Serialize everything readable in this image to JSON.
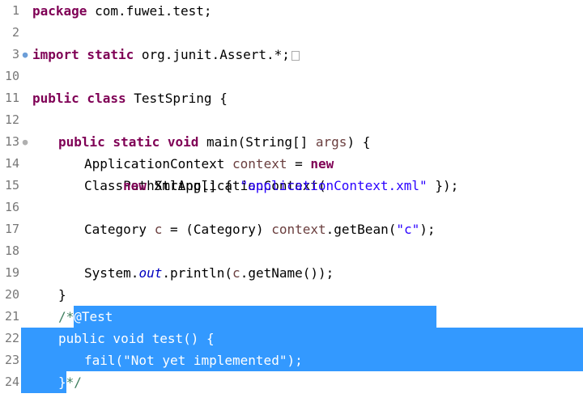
{
  "lines": [
    {
      "num": "1",
      "marker": "",
      "segments": [
        [
          "kw",
          "package "
        ],
        [
          "pkg",
          "com.fuwei.test"
        ],
        [
          "plain",
          ";"
        ]
      ]
    },
    {
      "num": "2",
      "marker": "",
      "segments": []
    },
    {
      "num": "3",
      "marker": "import",
      "segments": [
        [
          "kw",
          "import static "
        ],
        [
          "pkg",
          "org.junit.Assert.*"
        ],
        [
          "plain",
          ";"
        ]
      ],
      "fold": true
    },
    {
      "num": "10",
      "marker": "",
      "segments": []
    },
    {
      "num": "11",
      "marker": "",
      "segments": [
        [
          "kw",
          "public class "
        ],
        [
          "type",
          "TestSpring "
        ],
        [
          "plain",
          "{"
        ]
      ]
    },
    {
      "num": "12",
      "marker": "",
      "segments": []
    },
    {
      "num": "13",
      "marker": "method",
      "indent": 1,
      "segments": [
        [
          "kw",
          "public static void "
        ],
        [
          "type",
          "main"
        ],
        [
          "plain",
          "("
        ],
        [
          "type",
          "String"
        ],
        [
          "plain",
          "[] "
        ],
        [
          "var",
          "args"
        ],
        [
          "plain",
          ") {"
        ]
      ]
    },
    {
      "num": "14",
      "marker": "",
      "indent": 2,
      "segments": [
        [
          "type",
          "ApplicationContext "
        ],
        [
          "var",
          "context"
        ],
        [
          "plain",
          " = "
        ],
        [
          "kw",
          "new "
        ],
        [
          "type",
          "ClassPathXmlApplicationContext"
        ],
        [
          "plain",
          "("
        ]
      ]
    },
    {
      "num": "15",
      "marker": "",
      "indent": 3,
      "segments": [
        [
          "kw",
          "new "
        ],
        [
          "type",
          "String"
        ],
        [
          "plain",
          "[] { "
        ],
        [
          "str",
          "\"applicationContext.xml\""
        ],
        [
          "plain",
          " });"
        ]
      ]
    },
    {
      "num": "16",
      "marker": "",
      "segments": []
    },
    {
      "num": "17",
      "marker": "",
      "indent": 2,
      "segments": [
        [
          "type",
          "Category "
        ],
        [
          "var",
          "c"
        ],
        [
          "plain",
          " = ("
        ],
        [
          "type",
          "Category"
        ],
        [
          "plain",
          ") "
        ],
        [
          "var",
          "context"
        ],
        [
          "plain",
          ".getBean("
        ],
        [
          "str",
          "\"c\""
        ],
        [
          "plain",
          ");"
        ]
      ]
    },
    {
      "num": "18",
      "marker": "",
      "segments": []
    },
    {
      "num": "19",
      "marker": "",
      "indent": 2,
      "segments": [
        [
          "type",
          "System."
        ],
        [
          "field-static",
          "out"
        ],
        [
          "plain",
          ".println("
        ],
        [
          "var",
          "c"
        ],
        [
          "plain",
          ".getName());"
        ]
      ]
    },
    {
      "num": "20",
      "marker": "",
      "indent": 1,
      "segments": [
        [
          "plain",
          "}"
        ]
      ]
    },
    {
      "num": "21",
      "marker": "",
      "indent": 1,
      "selFrom": 0,
      "segments": [
        [
          "comment",
          "/*"
        ],
        [
          "comment-sel",
          "@Test"
        ]
      ]
    },
    {
      "num": "22",
      "marker": "",
      "indent": 1,
      "selected": true,
      "segments": [
        [
          "comment",
          "public void test() {"
        ]
      ]
    },
    {
      "num": "23",
      "marker": "",
      "indent": 2,
      "selected": true,
      "segments": [
        [
          "comment",
          "fail(\"Not yet implemented\");"
        ]
      ]
    },
    {
      "num": "24",
      "marker": "",
      "indent": 1,
      "partialSelEnd": true,
      "segments": [
        [
          "comment-sel",
          "}"
        ],
        [
          "comment",
          "*/"
        ]
      ]
    }
  ]
}
